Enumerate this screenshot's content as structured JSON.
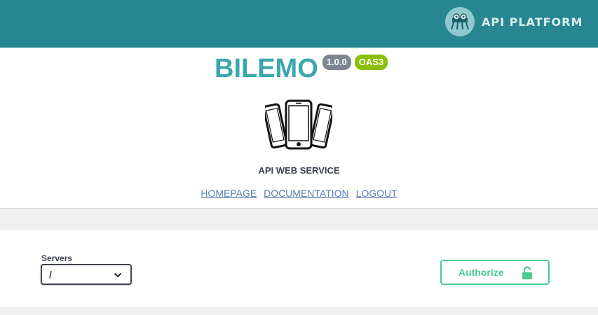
{
  "topbar": {
    "brand_text": "API PLATFORM",
    "brand_color": "#288690"
  },
  "info": {
    "title": "BILEMO",
    "version_badge": "1.0.0",
    "oas_badge": "OAS3",
    "subtitle": "API WEB SERVICE",
    "links": [
      {
        "label": "HOMEPAGE"
      },
      {
        "label": "DOCUMENTATION"
      },
      {
        "label": "LOGOUT"
      }
    ],
    "title_color": "#3aa7ae"
  },
  "scheme": {
    "servers_label": "Servers",
    "selected_server": "/",
    "authorize_label": "Authorize",
    "authorize_color": "#49cc90"
  }
}
